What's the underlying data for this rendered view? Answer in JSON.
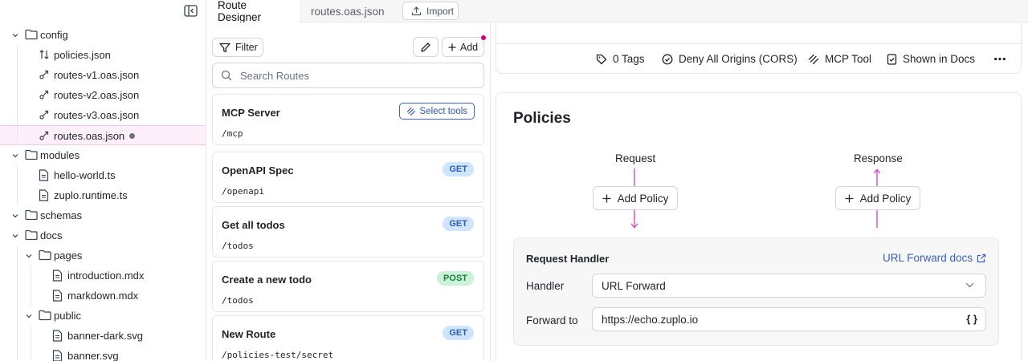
{
  "sidebar": {
    "tree": [
      {
        "label": "config",
        "kind": "folder",
        "expanded": true
      },
      {
        "label": "policies.json",
        "kind": "policies"
      },
      {
        "label": "routes-v1.oas.json",
        "kind": "route"
      },
      {
        "label": "routes-v2.oas.json",
        "kind": "route"
      },
      {
        "label": "routes-v3.oas.json",
        "kind": "route"
      },
      {
        "label": "routes.oas.json",
        "kind": "route",
        "selected": true,
        "modified": true
      },
      {
        "label": "modules",
        "kind": "folder",
        "expanded": true
      },
      {
        "label": "hello-world.ts",
        "kind": "file"
      },
      {
        "label": "zuplo.runtime.ts",
        "kind": "file"
      },
      {
        "label": "schemas",
        "kind": "folder",
        "expanded": true
      },
      {
        "label": "docs",
        "kind": "folder",
        "expanded": true
      },
      {
        "label": "pages",
        "kind": "folder",
        "expanded": true
      },
      {
        "label": "introduction.mdx",
        "kind": "file"
      },
      {
        "label": "markdown.mdx",
        "kind": "file"
      },
      {
        "label": "public",
        "kind": "folder",
        "expanded": true
      },
      {
        "label": "banner-dark.svg",
        "kind": "file"
      },
      {
        "label": "banner.svg",
        "kind": "file"
      }
    ]
  },
  "tabs": {
    "active": "Route Designer",
    "inactive": "routes.oas.json",
    "import_label": "Import"
  },
  "routes": {
    "filter_label": "Filter",
    "add_label": "Add",
    "search_placeholder": "Search Routes",
    "mcp": {
      "name": "MCP Server",
      "path": "/mcp",
      "select_tools": "Select tools"
    },
    "items": [
      {
        "name": "OpenAPI Spec",
        "path": "/openapi",
        "method": "GET"
      },
      {
        "name": "Get all todos",
        "path": "/todos",
        "method": "GET"
      },
      {
        "name": "Create a new todo",
        "path": "/todos",
        "method": "POST"
      },
      {
        "name": "New Route",
        "path": "/policies-test/secret",
        "method": "GET"
      }
    ]
  },
  "meta": {
    "tags": "0 Tags",
    "cors": "Deny All Origins (CORS)",
    "mcp": "MCP Tool",
    "docs": "Shown in Docs",
    "more": "⋯"
  },
  "policies": {
    "title": "Policies",
    "request_label": "Request",
    "response_label": "Response",
    "add_policy": "Add Policy"
  },
  "handler": {
    "title": "Request Handler",
    "docs_link": "URL Forward docs",
    "handler_label": "Handler",
    "handler_value": "URL Forward",
    "forward_label": "Forward to",
    "forward_value": "https://echo.zuplo.io",
    "braces": "{ }"
  },
  "colors": {
    "accent": "#d6007a",
    "link": "#3a5fc6",
    "get_badge": "#cfe4ff",
    "post_badge": "#c9f2d6"
  }
}
